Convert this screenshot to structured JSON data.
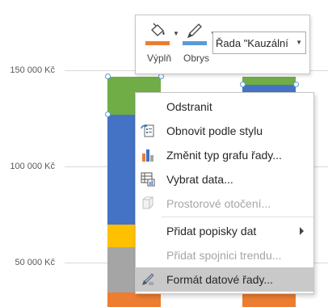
{
  "chart": {
    "y_axis_labels": [
      "150 000 Kč",
      "100 000 Kč",
      "50 000 Kč"
    ],
    "colors": {
      "green": "#70ad47",
      "blue": "#4472c4",
      "yellow": "#ffc000",
      "gray": "#a5a5a5",
      "orange": "#ed7d31",
      "grid": "#d9d9d9",
      "selection": "#5b9bd5"
    }
  },
  "mini_toolbar": {
    "fill_label": "Výplň",
    "outline_label": "Obrys",
    "fill_icon": "paint-bucket-icon",
    "outline_icon": "pencil-icon",
    "fill_color": "#ed7d31",
    "outline_color": "#5b9bd5",
    "series_selector_value": "Řada \"Kauzální"
  },
  "context_menu": {
    "items": [
      {
        "label": "Odstranit",
        "icon": "none",
        "disabled": false
      },
      {
        "label": "Obnovit podle stylu",
        "icon": "reset-style-icon",
        "disabled": false
      },
      {
        "label": "Změnit typ grafu řady...",
        "icon": "bar-chart-icon",
        "disabled": false
      },
      {
        "label": "Vybrat data...",
        "icon": "select-data-icon",
        "disabled": false
      },
      {
        "label": "Prostorové otočení...",
        "icon": "cube-icon",
        "disabled": true
      },
      {
        "label": "Přidat popisky dat",
        "icon": "none",
        "disabled": false,
        "submenu": true
      },
      {
        "label": "Přidat spojnici trendu...",
        "icon": "none",
        "disabled": true
      },
      {
        "label": "Formát datové řady...",
        "icon": "format-brush-icon",
        "disabled": false,
        "highlighted": true
      }
    ]
  }
}
